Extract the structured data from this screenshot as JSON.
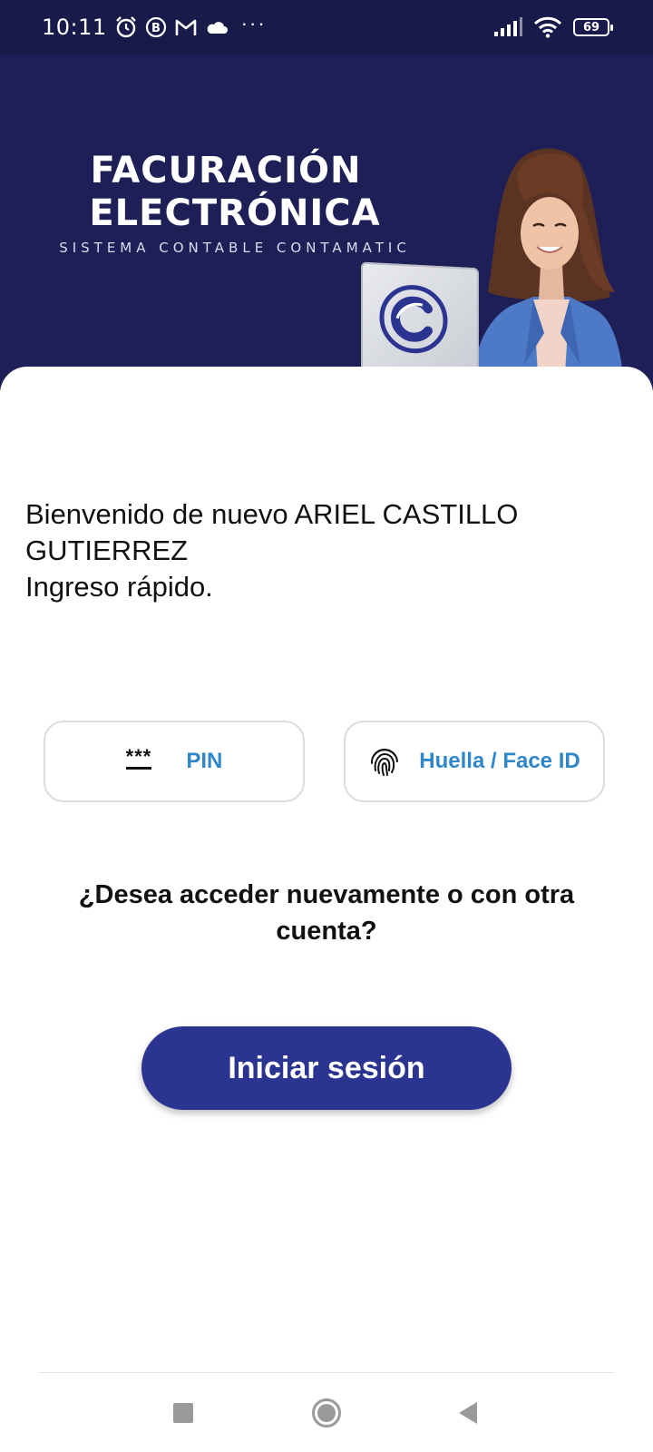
{
  "status_bar": {
    "time": "10:11",
    "icons": [
      "alarm-icon",
      "b-circle-icon",
      "gmail-icon",
      "cloud-icon"
    ],
    "more": "···",
    "battery": "69"
  },
  "banner": {
    "title_line1": "FACURACIÓN",
    "title_line2": "ELECTRÓNICA",
    "subtitle": "SISTEMA CONTABLE CONTAMATIC"
  },
  "welcome": {
    "line1": "Bienvenido de nuevo ARIEL CASTILLO",
    "line2": "GUTIERREZ",
    "line3": "Ingreso rápido."
  },
  "quick_options": {
    "pin": {
      "icon_text": "***",
      "label": "PIN"
    },
    "biometric": {
      "label": "Huella / Face ID"
    }
  },
  "question": "¿Desea acceder nuevamente o  con otra cuenta?",
  "login_button": "Iniciar sesión",
  "colors": {
    "banner_bg": "#1e1f57",
    "primary_button": "#2b3491",
    "option_text": "#2f86c9"
  }
}
